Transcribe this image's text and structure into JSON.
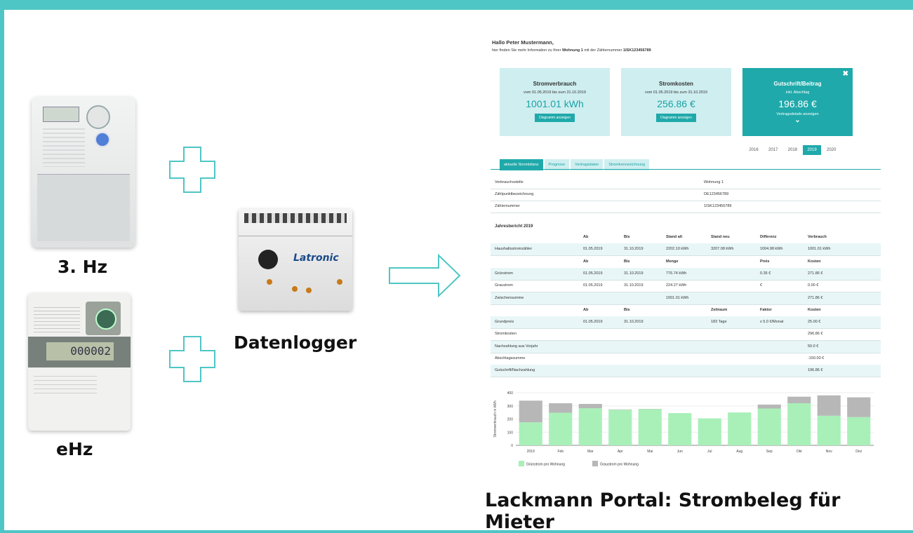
{
  "labels": {
    "meter1": "3. Hz",
    "meter2": "eHz",
    "logger": "Datenlogger",
    "caption": "Lackmann Portal: Strombeleg für Mieter"
  },
  "logger_brand": "Latronic",
  "portal": {
    "greeting": "Hallo Peter Mustermann,",
    "intro_prefix": "hier finden Sie mehr Information zu Ihrer ",
    "intro_unit": "Wohnung 1",
    "intro_middle": " mit der Zählernummer ",
    "intro_meter": "1ISK123456789",
    "cards": [
      {
        "title": "Stromverbrauch",
        "sub": "vom 01.05.2019 bis zum 31.10.2019",
        "value": "1001.01 kWh",
        "button": "Diagramm anzeigen"
      },
      {
        "title": "Stromkosten",
        "sub": "vom 01.05.2019 bis zum 31.10.2019",
        "value": "256.86 €",
        "button": "Diagramm anzeigen"
      },
      {
        "title": "Gutschrift/Beitrag",
        "sub": "inkl. Abschlag",
        "value": "196.86 €",
        "button": "Vertragsdetails anzeigen"
      }
    ],
    "years": [
      "2016",
      "2017",
      "2018",
      "2019",
      "2020"
    ],
    "active_year": "2019",
    "tabs": [
      "aktuelle Strombilanz",
      "Prognose",
      "Vertragsdaten",
      "Stromkennzeichnung"
    ],
    "info": [
      {
        "label": "Verbrauchsstelle",
        "value": "Wohnung 1"
      },
      {
        "label": "Zählpunktbezeichnung",
        "value": "DE123456789"
      },
      {
        "label": "Zählernummer",
        "value": "1ISK123456789"
      }
    ],
    "report_title": "Jahresbericht 2019",
    "table_rows": [
      {
        "type": "hdr",
        "cells": [
          "",
          "Ab",
          "Bis",
          "Stand alt",
          "Stand neu",
          "Differenz",
          "Verbrauch"
        ]
      },
      {
        "type": "shade",
        "cells": [
          "Haushaltsstromzähler",
          "01.05.2019",
          "31.10.2019",
          "2202.10 kWh",
          "3207.08 kWh",
          "1004.98 kWh",
          "1001.01 kWh"
        ]
      },
      {
        "type": "hdr",
        "cells": [
          "",
          "Ab",
          "Bis",
          "Menge",
          "",
          "Preis",
          "Kosten"
        ]
      },
      {
        "type": "shade",
        "cells": [
          "Grünstrom",
          "01.05.2019",
          "31.10.2019",
          "776.74 kWh",
          "",
          "0.35 €",
          "271.86 €"
        ]
      },
      {
        "type": "plain",
        "cells": [
          "Graustrom",
          "01.05.2019",
          "31.10.2019",
          "224.27 kWh",
          "",
          "€",
          "0.00 €"
        ]
      },
      {
        "type": "shade",
        "cells": [
          "Zwischensumme",
          "",
          "",
          "1001.01 kWh",
          "",
          "",
          "271.86 €"
        ]
      },
      {
        "type": "hdr",
        "cells": [
          "",
          "Ab",
          "Bis",
          "",
          "Zeitraum",
          "Faktor",
          "Kosten"
        ]
      },
      {
        "type": "shade",
        "cells": [
          "Grundpreis",
          "01.05.2019",
          "31.10.2019",
          "",
          "183 Tage",
          "x 5.0 €/Monat",
          "25.00 €"
        ]
      },
      {
        "type": "plain",
        "cells": [
          "Stromkosten",
          "",
          "",
          "",
          "",
          "",
          "296.86 €"
        ]
      },
      {
        "type": "shade",
        "cells": [
          "Nachzahlung aus Vorjahr",
          "",
          "",
          "",
          "",
          "",
          "50.0 €"
        ]
      },
      {
        "type": "plain",
        "cells": [
          "Abschlagssumme",
          "",
          "",
          "",
          "",
          "",
          "-150.00 €"
        ]
      },
      {
        "type": "shade",
        "cells": [
          "Gutschrift/Nachzahlung",
          "",
          "",
          "",
          "",
          "",
          "196.86 €"
        ]
      }
    ]
  },
  "chart_data": {
    "type": "bar",
    "stacked": true,
    "categories": [
      "2019",
      "Feb",
      "Mar",
      "Apr",
      "Mai",
      "Jun",
      "Jul",
      "Aug",
      "Sep",
      "Okt",
      "Nov",
      "Dez"
    ],
    "series": [
      {
        "name": "Grünstrom pro Wohnung",
        "color": "#a8f0b8",
        "values": [
          175,
          248,
          282,
          270,
          275,
          245,
          205,
          250,
          280,
          320,
          225,
          215
        ]
      },
      {
        "name": "Graustrom pro Wohnung",
        "color": "#b7b7b7",
        "values": [
          165,
          72,
          33,
          3,
          2,
          0,
          0,
          0,
          30,
          50,
          155,
          150
        ]
      }
    ],
    "ylabel": "Stromverbrauch in kWh",
    "ylim": [
      0,
      400
    ],
    "yticks": [
      0,
      100,
      200,
      300,
      400
    ],
    "legend": "bottom-left"
  },
  "colors": {
    "accent": "#1fa9aa",
    "frame": "#4ec6c5",
    "light": "#cfeef0"
  }
}
